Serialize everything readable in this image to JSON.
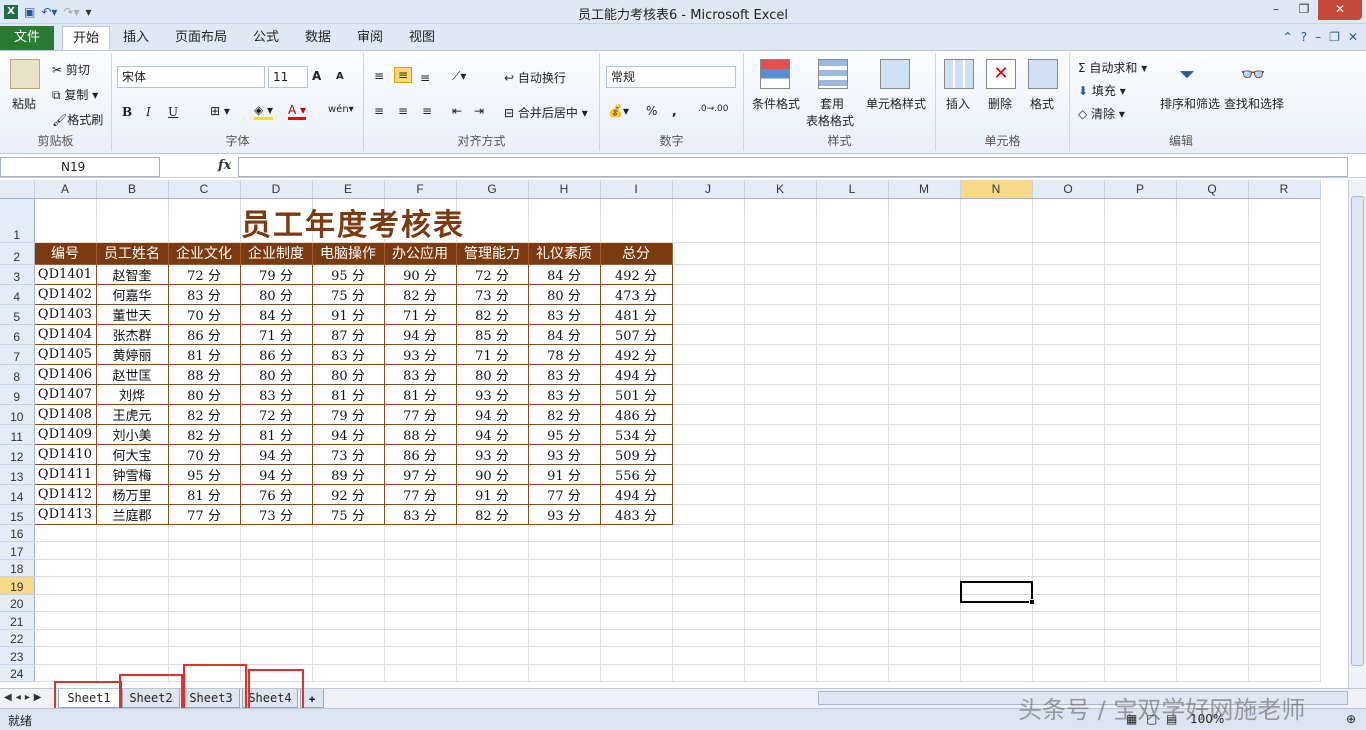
{
  "window": {
    "title": "员工能力考核表6 - Microsoft Excel",
    "minimize": "–",
    "restore": "❐",
    "close": "✕"
  },
  "ribbon_tabs": {
    "file": "文件",
    "items": [
      "开始",
      "插入",
      "页面布局",
      "公式",
      "数据",
      "审阅",
      "视图"
    ]
  },
  "clipboard": {
    "paste": "粘贴",
    "cut": "剪切",
    "copy": "复制",
    "format_painter": "格式刷",
    "label": "剪贴板"
  },
  "font": {
    "name": "宋体",
    "size": "11",
    "bold": "B",
    "italic": "I",
    "underline": "U",
    "label": "字体",
    "grow": "A",
    "shrink": "A"
  },
  "alignment": {
    "wrap": "自动换行",
    "merge": "合并后居中",
    "label": "对齐方式"
  },
  "number": {
    "format": "常规",
    "percent": "%",
    "comma": ",",
    "label": "数字"
  },
  "styles": {
    "conditional": "条件格式",
    "table_fmt_1": "套用",
    "table_fmt_2": "表格格式",
    "cell_styles": "单元格样式",
    "label": "样式"
  },
  "cells": {
    "insert": "插入",
    "delete": "删除",
    "format": "格式",
    "label": "单元格"
  },
  "editing": {
    "autosum": "自动求和",
    "fill": "填充",
    "clear": "清除",
    "sort": "排序和筛选",
    "find": "查找和选择",
    "label": "编辑"
  },
  "formula_bar": {
    "name_box": "N19",
    "fx": "fx",
    "formula": ""
  },
  "columns": [
    "A",
    "B",
    "C",
    "D",
    "E",
    "F",
    "G",
    "H",
    "I",
    "J",
    "K",
    "L",
    "M",
    "N",
    "O",
    "P",
    "Q",
    "R"
  ],
  "selected_column": "N",
  "selected_row": "19",
  "sheet": {
    "title": "员工年度考核表",
    "headers": [
      "编号",
      "员工姓名",
      "企业文化",
      "企业制度",
      "电脑操作",
      "办公应用",
      "管理能力",
      "礼仪素质",
      "总分"
    ],
    "rows": [
      [
        "QD1401",
        "赵智奎",
        "72 分",
        "79 分",
        "95 分",
        "90 分",
        "72 分",
        "84 分",
        "492 分"
      ],
      [
        "QD1402",
        "何嘉华",
        "83 分",
        "80 分",
        "75 分",
        "82 分",
        "73 分",
        "80 分",
        "473 分"
      ],
      [
        "QD1403",
        "董世天",
        "70 分",
        "84 分",
        "91 分",
        "71 分",
        "82 分",
        "83 分",
        "481 分"
      ],
      [
        "QD1404",
        "张杰群",
        "86 分",
        "71 分",
        "87 分",
        "94 分",
        "85 分",
        "84 分",
        "507 分"
      ],
      [
        "QD1405",
        "黄婷丽",
        "81 分",
        "86 分",
        "83 分",
        "93 分",
        "71 分",
        "78 分",
        "492 分"
      ],
      [
        "QD1406",
        "赵世匡",
        "88 分",
        "80 分",
        "80 分",
        "83 分",
        "80 分",
        "83 分",
        "494 分"
      ],
      [
        "QD1407",
        "刘烨",
        "80 分",
        "83 分",
        "81 分",
        "81 分",
        "93 分",
        "83 分",
        "501 分"
      ],
      [
        "QD1408",
        "王虎元",
        "82 分",
        "72 分",
        "79 分",
        "77 分",
        "94 分",
        "82 分",
        "486 分"
      ],
      [
        "QD1409",
        "刘小美",
        "82 分",
        "81 分",
        "94 分",
        "88 分",
        "94 分",
        "95 分",
        "534 分"
      ],
      [
        "QD1410",
        "何大宝",
        "70 分",
        "94 分",
        "73 分",
        "86 分",
        "93 分",
        "93 分",
        "509 分"
      ],
      [
        "QD1411",
        "钟雪梅",
        "95 分",
        "94 分",
        "89 分",
        "97 分",
        "90 分",
        "91 分",
        "556 分"
      ],
      [
        "QD1412",
        "杨万里",
        "81 分",
        "76 分",
        "92 分",
        "77 分",
        "91 分",
        "77 分",
        "494 分"
      ],
      [
        "QD1413",
        "兰庭郡",
        "77 分",
        "73 分",
        "75 分",
        "83 分",
        "82 分",
        "93 分",
        "483 分"
      ]
    ]
  },
  "sheet_tabs": [
    "Sheet1",
    "Sheet2",
    "Sheet3",
    "Sheet4"
  ],
  "active_sheet": "Sheet1",
  "status": {
    "ready": "就绪",
    "zoom": "100%"
  },
  "watermark": "头条号 / 宝双学好网施老师",
  "colors": {
    "header_bg": "#7b3a10",
    "title": "#7b3a10",
    "highlight_box": "#e03030",
    "file_tab": "#2a7a34"
  }
}
